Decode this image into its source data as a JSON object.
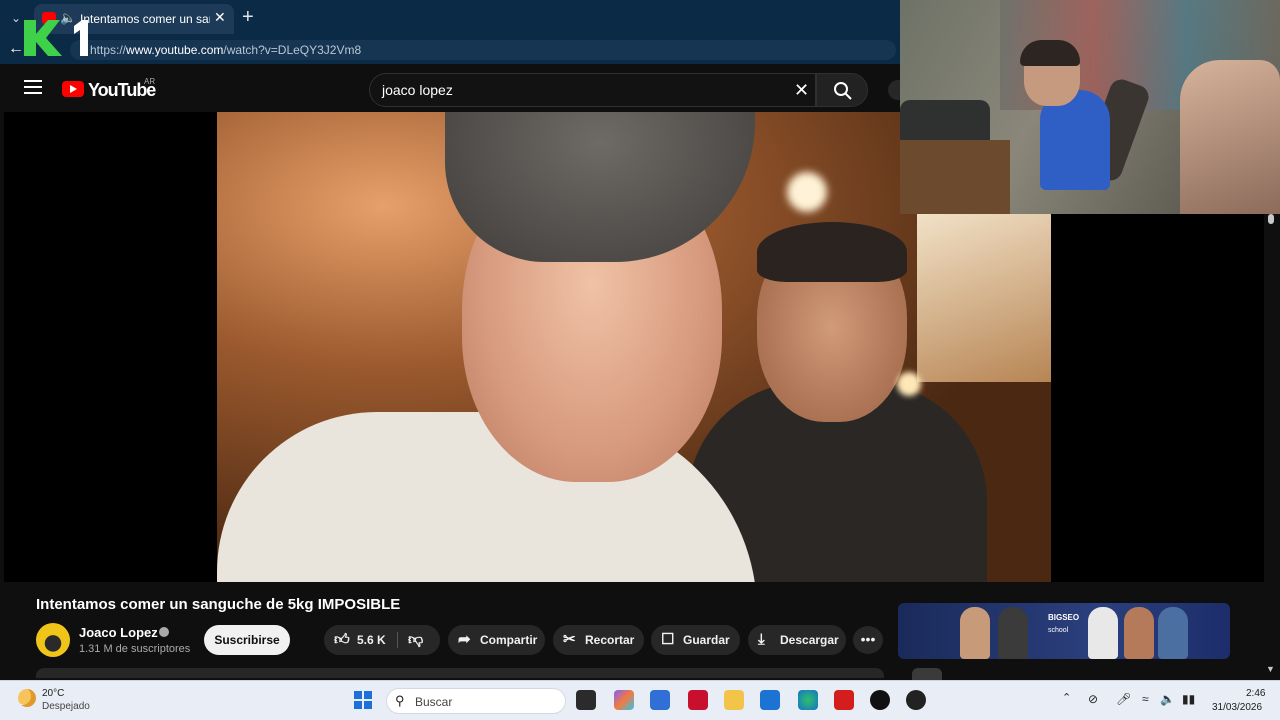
{
  "browser": {
    "tab_title": "Intentamos comer un sanguc",
    "url_prefix": "https://",
    "url_host": "www.youtube.com",
    "url_path": "/watch?v=DLeQY3J2Vm8"
  },
  "youtube": {
    "logo_text": "YouTube",
    "country": "AR",
    "search_query": "joaco lopez"
  },
  "video": {
    "title": "Intentamos comer un sanguche de 5kg IMPOSIBLE",
    "channel": "Joaco Lopez",
    "subscribers": "1.31 M de suscriptores",
    "subscribe_label": "Suscribirse",
    "likes": "5.6 K",
    "share_label": "Compartir",
    "clip_label": "Recortar",
    "save_label": "Guardar",
    "download_label": "Descargar",
    "more_label": "•••"
  },
  "ad": {
    "brand": "BIGSEO",
    "sub": "school"
  },
  "taskbar": {
    "temperature": "20°C",
    "weather": "Despejado",
    "search_label": "Buscar",
    "time": "2:46",
    "date": "31/03/2026"
  },
  "colors": {
    "youtube_red": "#ff0000",
    "browser_chrome": "#0b2a45",
    "taskbar": "#e9eef6"
  }
}
